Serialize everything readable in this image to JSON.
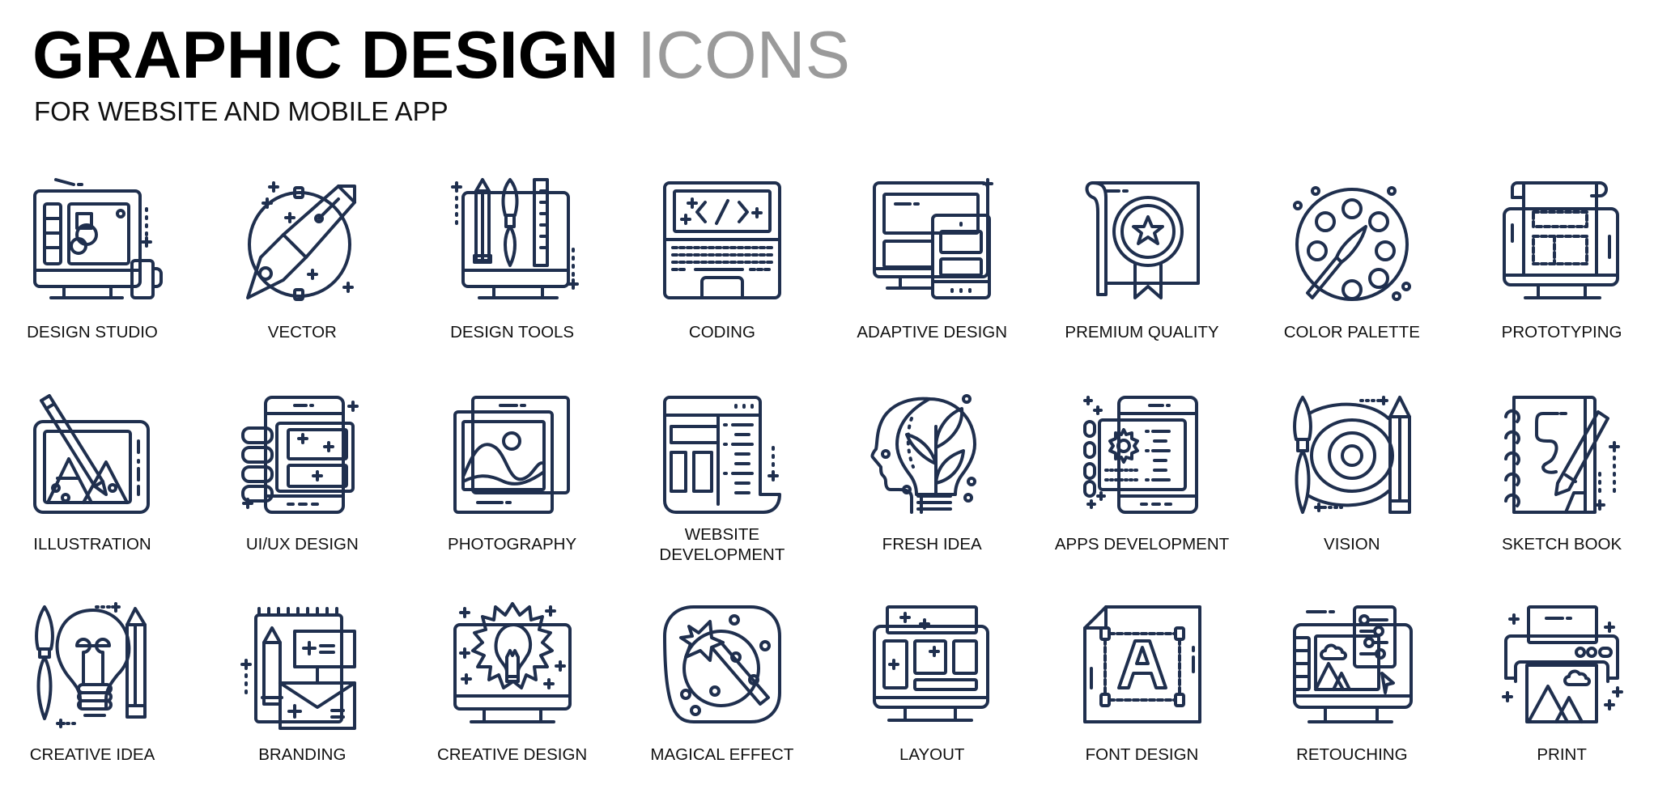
{
  "header": {
    "title_bold": "GRAPHIC DESIGN",
    "title_light": "ICONS",
    "subtitle": "FOR WEBSITE AND MOBILE APP"
  },
  "colors": {
    "icon_stroke": "#1f2f4e",
    "title": "#000000",
    "title_accent": "#9a9a9a",
    "label": "#111111"
  },
  "icons": [
    {
      "label": "DESIGN STUDIO",
      "icon": "design-studio-icon"
    },
    {
      "label": "VECTOR",
      "icon": "vector-pen-icon"
    },
    {
      "label": "DESIGN TOOLS",
      "icon": "design-tools-icon"
    },
    {
      "label": "CODING",
      "icon": "coding-laptop-icon"
    },
    {
      "label": "ADAPTIVE DESIGN",
      "icon": "adaptive-design-icon"
    },
    {
      "label": "PREMIUM QUALITY",
      "icon": "premium-quality-icon"
    },
    {
      "label": "COLOR PALETTE",
      "icon": "color-palette-icon"
    },
    {
      "label": "PROTOTYPING",
      "icon": "prototyping-icon"
    },
    {
      "label": "ILLUSTRATION",
      "icon": "illustration-icon"
    },
    {
      "label": "UI/UX DESIGN",
      "icon": "ui-ux-design-icon"
    },
    {
      "label": "PHOTOGRAPHY",
      "icon": "photography-icon"
    },
    {
      "label": "WEBSITE\nDEVELOPMENT",
      "icon": "website-development-icon"
    },
    {
      "label": "FRESH IDEA",
      "icon": "fresh-idea-icon"
    },
    {
      "label": "APPS DEVELOPMENT",
      "icon": "apps-development-icon"
    },
    {
      "label": "VISION",
      "icon": "vision-icon"
    },
    {
      "label": "SKETCH BOOK",
      "icon": "sketch-book-icon"
    },
    {
      "label": "CREATIVE IDEA",
      "icon": "creative-idea-icon"
    },
    {
      "label": "BRANDING",
      "icon": "branding-icon"
    },
    {
      "label": "CREATIVE DESIGN",
      "icon": "creative-design-icon"
    },
    {
      "label": "MAGICAL EFFECT",
      "icon": "magical-effect-icon"
    },
    {
      "label": "LAYOUT",
      "icon": "layout-icon"
    },
    {
      "label": "FONT DESIGN",
      "icon": "font-design-icon"
    },
    {
      "label": "RETOUCHING",
      "icon": "retouching-icon"
    },
    {
      "label": "PRINT",
      "icon": "print-icon"
    }
  ]
}
